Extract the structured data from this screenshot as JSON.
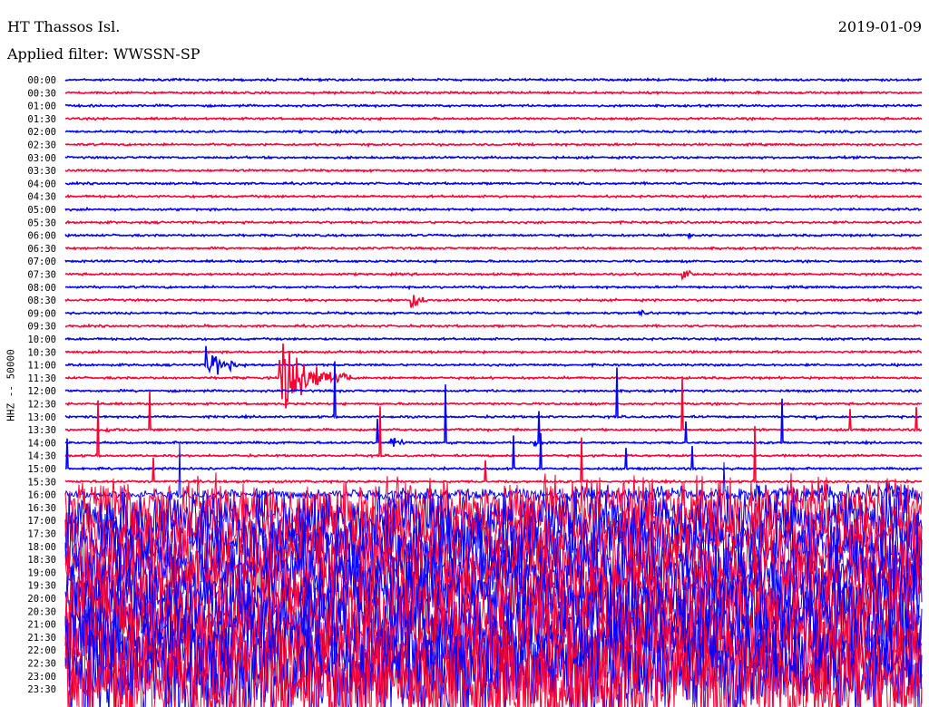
{
  "header": {
    "station": "HT Thassos Isl.",
    "filter": "Applied filter: WWSSN-SP",
    "date": "2019-01-09"
  },
  "chart_data": {
    "type": "line",
    "title": "HT Thassos Isl.",
    "subtitle": "Applied filter: WWSSN-SP",
    "date": "2019-01-09",
    "ylabel": "HHZ -- 50000",
    "xlabel": "",
    "minutes_per_line": 30,
    "row_labels": [
      "00:00",
      "00:30",
      "01:00",
      "01:30",
      "02:00",
      "02:30",
      "03:00",
      "03:30",
      "04:00",
      "04:30",
      "05:00",
      "05:30",
      "06:00",
      "06:30",
      "07:00",
      "07:30",
      "08:00",
      "08:30",
      "09:00",
      "09:30",
      "10:00",
      "10:30",
      "11:00",
      "11:30",
      "12:00",
      "12:30",
      "13:00",
      "13:30",
      "14:00",
      "14:30",
      "15:00",
      "15:30",
      "16:00",
      "16:30",
      "17:00",
      "17:30",
      "18:00",
      "18:30",
      "19:00",
      "19:30",
      "20:00",
      "20:30",
      "21:00",
      "21:30",
      "22:00",
      "22:30",
      "23:00",
      "23:30"
    ],
    "colors": {
      "even": "#0000ff",
      "odd": "#ff0033"
    },
    "noise_onset_row": "16:00",
    "events": [
      {
        "row": "11:30",
        "minute": 7.5,
        "amplitude": 40,
        "duration_min": 2.5
      },
      {
        "row": "11:00",
        "minute": 4.9,
        "amplitude": 18,
        "duration_min": 1.4
      },
      {
        "row": "08:30",
        "minute": 12.1,
        "amplitude": 12,
        "duration_min": 0.6
      },
      {
        "row": "07:30",
        "minute": 21.6,
        "amplitude": 8,
        "duration_min": 0.5
      },
      {
        "row": "09:00",
        "minute": 20.1,
        "amplitude": 6,
        "duration_min": 0.4
      },
      {
        "row": "14:00",
        "minute": 11.4,
        "amplitude": 10,
        "duration_min": 0.6
      },
      {
        "row": "14:00",
        "minute": 16.4,
        "amplitude": 8,
        "duration_min": 0.5
      },
      {
        "row": "13:30",
        "minute": 1.4,
        "amplitude": 6,
        "duration_min": 0.3
      },
      {
        "row": "13:00",
        "minute": 26.3,
        "amplitude": 5,
        "duration_min": 0.3
      },
      {
        "row": "06:00",
        "minute": 21.8,
        "amplitude": 4,
        "duration_min": 0.3
      }
    ]
  }
}
